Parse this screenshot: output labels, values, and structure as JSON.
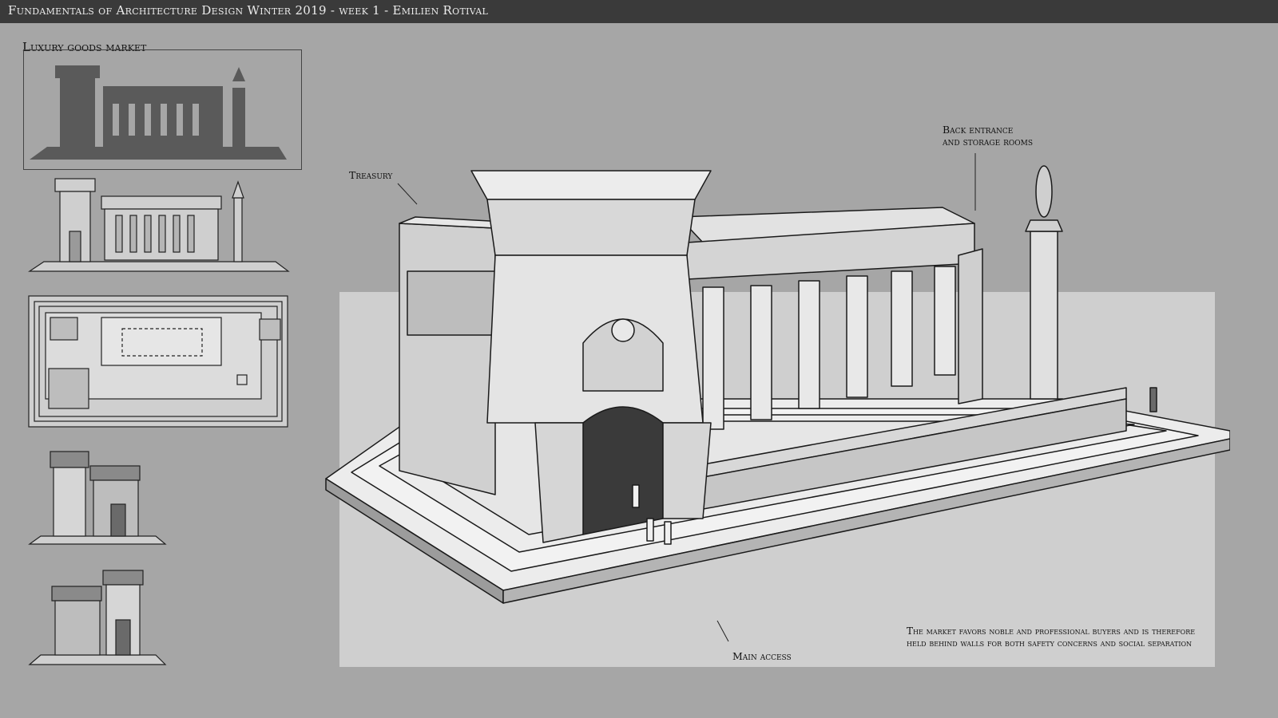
{
  "header": {
    "title": "Fundamentals of Architecture Design Winter 2019 - week 1 - Emilien Rotival"
  },
  "sidebar": {
    "section_label": "Luxury goods market"
  },
  "annotations": {
    "treasury": "Treasury",
    "back_entrance_line1": "Back entrance",
    "back_entrance_line2": "and storage rooms",
    "main_access": "Main access",
    "note": "The market favors noble and professional buyers and is therefore held behind walls for both safety concerns and social separation"
  },
  "colors": {
    "header_bg": "#3a3a3a",
    "page_bg": "#a6a6a6",
    "stage_bg": "#cfcfcf",
    "silhouette": "#5a5a5a",
    "ink": "#1a1a1a"
  }
}
